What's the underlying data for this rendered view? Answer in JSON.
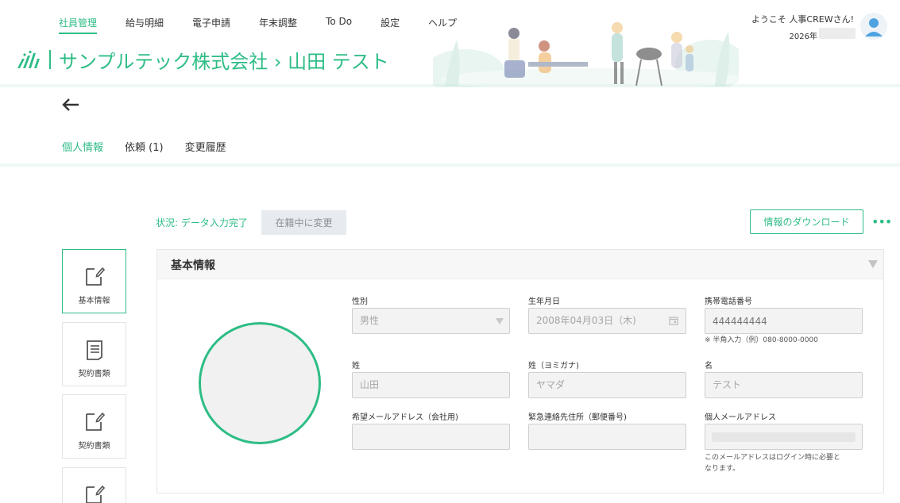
{
  "nav": {
    "items": [
      "社員管理",
      "給与明細",
      "電子申請",
      "年末調整",
      "To Do",
      "設定",
      "ヘルプ"
    ],
    "active_index": 0
  },
  "header": {
    "title": "サンプルテック株式会社 › 山田 テスト",
    "welcome": "ようこそ 人事CREWさん!",
    "year": "2026年"
  },
  "tabs": [
    {
      "label": "個人情報",
      "active": true
    },
    {
      "label": "依頼 (1)",
      "active": false
    },
    {
      "label": "変更履歴",
      "active": false
    }
  ],
  "status": {
    "text": "状況: データ入力完了",
    "change_button": "在籍中に変更",
    "download_button": "情報のダウンロード",
    "more": "•••"
  },
  "side_menu": [
    {
      "label": "基本情報",
      "icon": "edit-note-icon",
      "active": true
    },
    {
      "label": "契約書類",
      "icon": "document-list-icon",
      "active": false
    },
    {
      "label": "契約書類",
      "icon": "edit-note-icon",
      "active": false
    },
    {
      "label": "",
      "icon": "edit-note-icon",
      "active": false
    }
  ],
  "panel": {
    "title": "基本情報"
  },
  "fields": {
    "gender": {
      "label": "性別",
      "value": "男性"
    },
    "birthdate": {
      "label": "生年月日",
      "value": "2008年04月03日（木)"
    },
    "mobile": {
      "label": "携帯電話番号",
      "placeholder": "444444444",
      "hint": "※ 半角入力（例）080-8000-0000"
    },
    "last_name": {
      "label": "姓",
      "value": "山田"
    },
    "last_name_kana": {
      "label": "姓（ヨミガナ)",
      "value": "ヤマダ"
    },
    "first_name": {
      "label": "名",
      "value": "テスト"
    },
    "preferred_email": {
      "label": "希望メールアドレス（会社用)",
      "value": ""
    },
    "emergency_postal": {
      "label": "緊急連絡先住所（郵便番号)",
      "value": ""
    },
    "personal_email": {
      "label": "個人メールアドレス",
      "hint_line1": "このメールアドレスはログイン時に必要と",
      "hint_line2": "なります。"
    }
  },
  "colors": {
    "accent": "#2ebd85",
    "field_bg": "#f3f3f3",
    "disabled_button": "#e7ebf0"
  }
}
